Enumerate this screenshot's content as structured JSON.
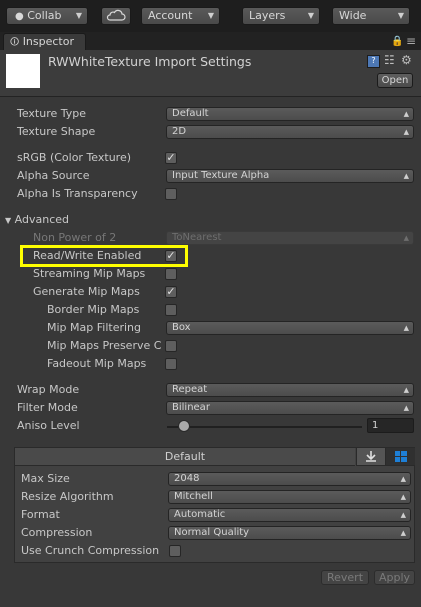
{
  "toolbar": {
    "collab": "Collab",
    "cloud_icon": "cloud-icon",
    "account": "Account",
    "layers": "Layers",
    "layout": "Wide"
  },
  "tab": {
    "label": "Inspector"
  },
  "header": {
    "title": "RWWhiteTexture Import Settings",
    "open_label": "Open"
  },
  "fields": {
    "texture_type": {
      "label": "Texture Type",
      "value": "Default"
    },
    "texture_shape": {
      "label": "Texture Shape",
      "value": "2D"
    },
    "srgb": {
      "label": "sRGB (Color Texture)",
      "checked": true
    },
    "alpha_source": {
      "label": "Alpha Source",
      "value": "Input Texture Alpha"
    },
    "alpha_transparency": {
      "label": "Alpha Is Transparency",
      "checked": false
    },
    "advanced": {
      "label": "Advanced"
    },
    "non_power_of_2": {
      "label": "Non Power of 2",
      "value": "ToNearest"
    },
    "read_write": {
      "label": "Read/Write Enabled",
      "checked": true
    },
    "streaming_mip": {
      "label": "Streaming Mip Maps",
      "checked": false
    },
    "generate_mip": {
      "label": "Generate Mip Maps",
      "checked": true
    },
    "border_mip": {
      "label": "Border Mip Maps",
      "checked": false
    },
    "mip_filtering": {
      "label": "Mip Map Filtering",
      "value": "Box"
    },
    "mip_preserve": {
      "label": "Mip Maps Preserve C",
      "checked": false
    },
    "fadeout_mip": {
      "label": "Fadeout Mip Maps",
      "checked": false
    },
    "wrap_mode": {
      "label": "Wrap Mode",
      "value": "Repeat"
    },
    "filter_mode": {
      "label": "Filter Mode",
      "value": "Bilinear"
    },
    "aniso_level": {
      "label": "Aniso Level",
      "value": "1",
      "fraction": 0.0625
    }
  },
  "platform": {
    "tab_label": "Default",
    "max_size": {
      "label": "Max Size",
      "value": "2048"
    },
    "resize_algorithm": {
      "label": "Resize Algorithm",
      "value": "Mitchell"
    },
    "format": {
      "label": "Format",
      "value": "Automatic"
    },
    "compression": {
      "label": "Compression",
      "value": "Normal Quality"
    },
    "crunch": {
      "label": "Use Crunch Compression",
      "checked": false
    }
  },
  "buttons": {
    "revert": "Revert",
    "apply": "Apply"
  },
  "colors": {
    "highlight": "#ffff00",
    "windows_blue": "#1e7fd6"
  }
}
